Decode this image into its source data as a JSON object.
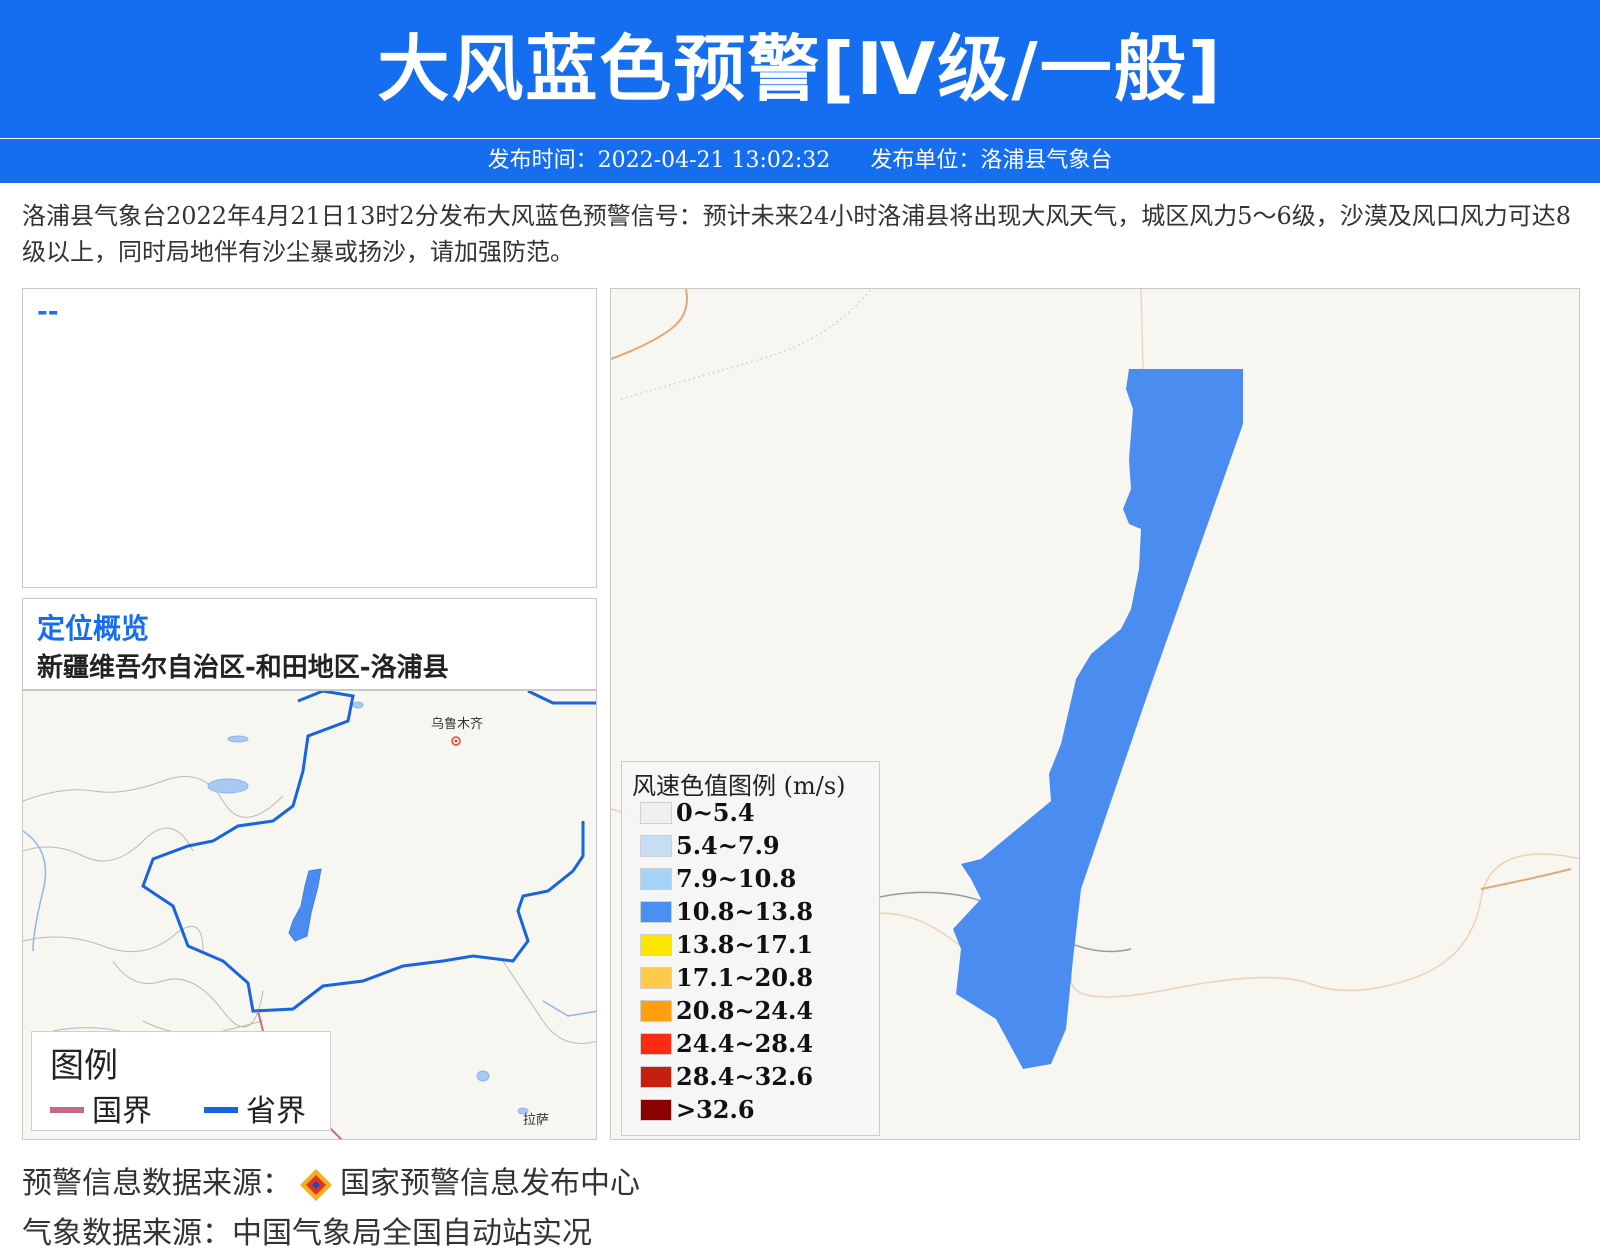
{
  "header": {
    "title": "大风蓝色预警[Ⅳ级/一般]",
    "publish_time": "发布时间：2022-04-21 13:02:32",
    "publisher": "发布单位：洛浦县气象台"
  },
  "description": "洛浦县气象台2022年4月21日13时2分发布大风蓝色预警信号：预计未来24小时洛浦县将出现大风天气，城区风力5～6级，沙漠及风口风力可达8级以上，同时局地伴有沙尘暴或扬沙，请加强防范。",
  "note": "--",
  "location": {
    "title": "定位概览",
    "path": "新疆维吾尔自治区-和田地区-洛浦县"
  },
  "overview_map": {
    "city_labels": [
      "乌鲁木齐",
      "拉萨"
    ],
    "legend": {
      "title": "图例",
      "items": [
        {
          "label": "国界",
          "color": "#c46c80"
        },
        {
          "label": "省界",
          "color": "#1565e0"
        }
      ]
    }
  },
  "wind_legend": {
    "title": "风速色值图例 (m/s)",
    "items": [
      {
        "label": "0~5.4",
        "color": "#f0f0f0"
      },
      {
        "label": "5.4~7.9",
        "color": "#c6def3"
      },
      {
        "label": "7.9~10.8",
        "color": "#a4d4f7"
      },
      {
        "label": "10.8~13.8",
        "color": "#4a90f0"
      },
      {
        "label": "13.8~17.1",
        "color": "#ffe600"
      },
      {
        "label": "17.1~20.8",
        "color": "#ffc94a"
      },
      {
        "label": "20.8~24.4",
        "color": "#ff9f0f"
      },
      {
        "label": "24.4~28.4",
        "color": "#ff2a12"
      },
      {
        "label": "28.4~32.6",
        "color": "#c81e0f"
      },
      {
        "label": ">32.6",
        "color": "#8b0000"
      }
    ]
  },
  "alert_area_color": "#4a8cf0",
  "sources": {
    "warning_label": "预警信息数据来源：",
    "warning_source": "国家预警信息发布中心",
    "weather": "气象数据来源：中国气象局全国自动站实况"
  }
}
